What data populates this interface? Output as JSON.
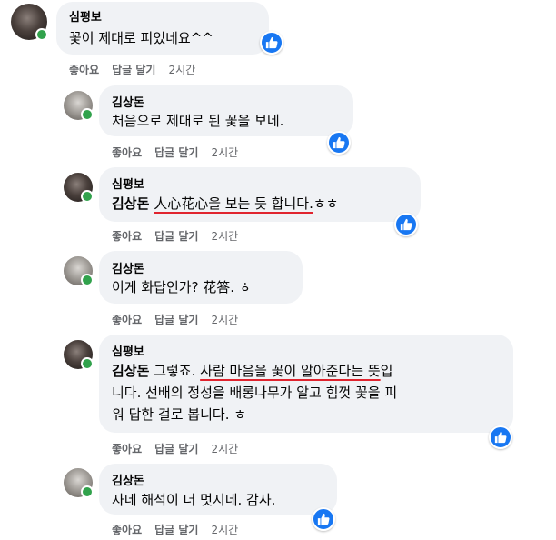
{
  "comments": [
    {
      "author": "심평보",
      "text": "꽃이 제대로 피었네요^^",
      "actions": {
        "like": "좋아요",
        "reply": "답글 달기",
        "time": "2시간"
      }
    },
    {
      "author": "김상돈",
      "text": "처음으로 제대로 된 꽃을 보네.",
      "actions": {
        "like": "좋아요",
        "reply": "답글 달기",
        "time": "2시간"
      }
    },
    {
      "author": "심평보",
      "mention": "김상돈",
      "underlined": "人心花心을 보는 듯 합니다.",
      "tail": "ㅎㅎ",
      "actions": {
        "like": "좋아요",
        "reply": "답글 달기",
        "time": "2시간"
      }
    },
    {
      "author": "김상돈",
      "text": "이게 화답인가? 花答. ㅎ",
      "actions": {
        "like": "좋아요",
        "reply": "답글 달기",
        "time": "2시간"
      }
    },
    {
      "author": "심평보",
      "mention": "김상돈",
      "pre": "그렇죠.",
      "underlined": "사람 마음을 꽃이 알아준다는 뜻",
      "post1": "입",
      "line2": "니다. 선배의 정성을 배롱나무가 알고 힘껏 꽃을 피",
      "line3": "워 답한 걸로 봅니다. ㅎ",
      "actions": {
        "like": "좋아요",
        "reply": "답글 달기",
        "time": "2시간"
      }
    },
    {
      "author": "김상돈",
      "text": "자네 해석이 더 멋지네. 감사.",
      "actions": {
        "like": "좋아요",
        "reply": "답글 달기",
        "time": "2시간"
      }
    }
  ],
  "colors": {
    "bubble": "#f0f2f5",
    "like": "#1877f2",
    "online": "#31a24c",
    "underline": "#e0242e",
    "meta": "#65676b"
  },
  "icons": {
    "reaction": "thumbs-up-icon",
    "presence": "online-dot-icon"
  }
}
